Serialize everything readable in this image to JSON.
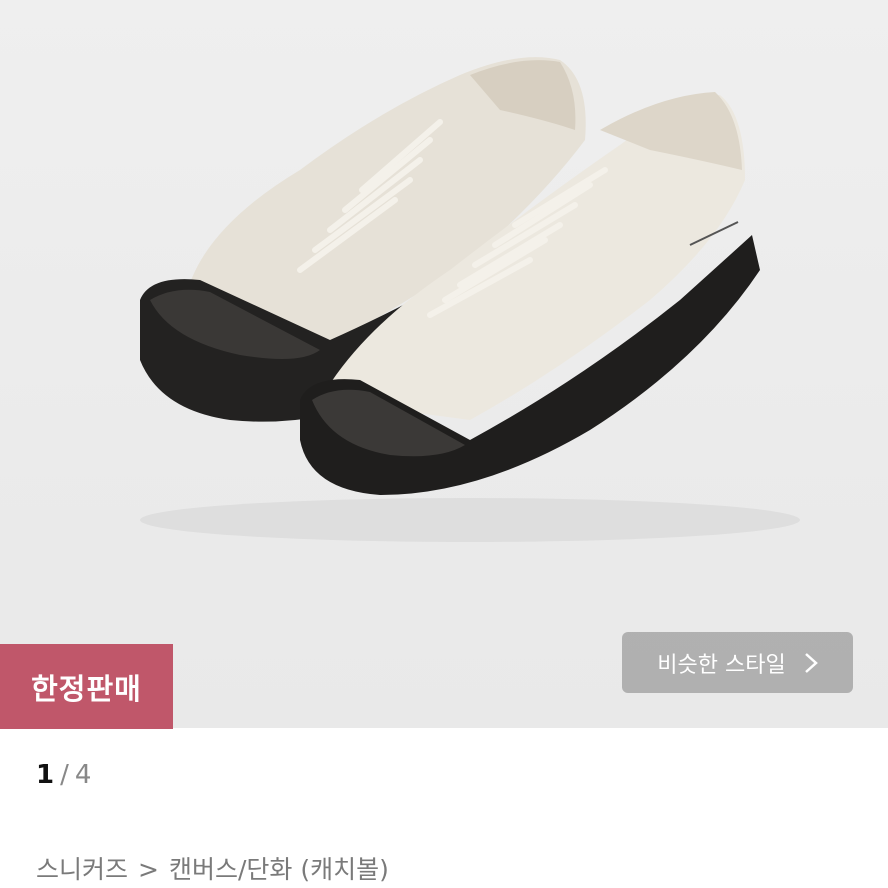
{
  "badge": {
    "label": "한정판매",
    "color": "#c0576a"
  },
  "similar_style_button": {
    "label": "비슷한 스타일",
    "icon": "chevron-right-icon"
  },
  "gallery": {
    "current": "1",
    "separator": "/",
    "total": "4"
  },
  "breadcrumb": {
    "category": "스니커즈",
    "separator": ">",
    "subcategory": "캔버스/단화 (캐치볼)"
  },
  "product_image": {
    "icon": "sneaker-pair-image"
  }
}
